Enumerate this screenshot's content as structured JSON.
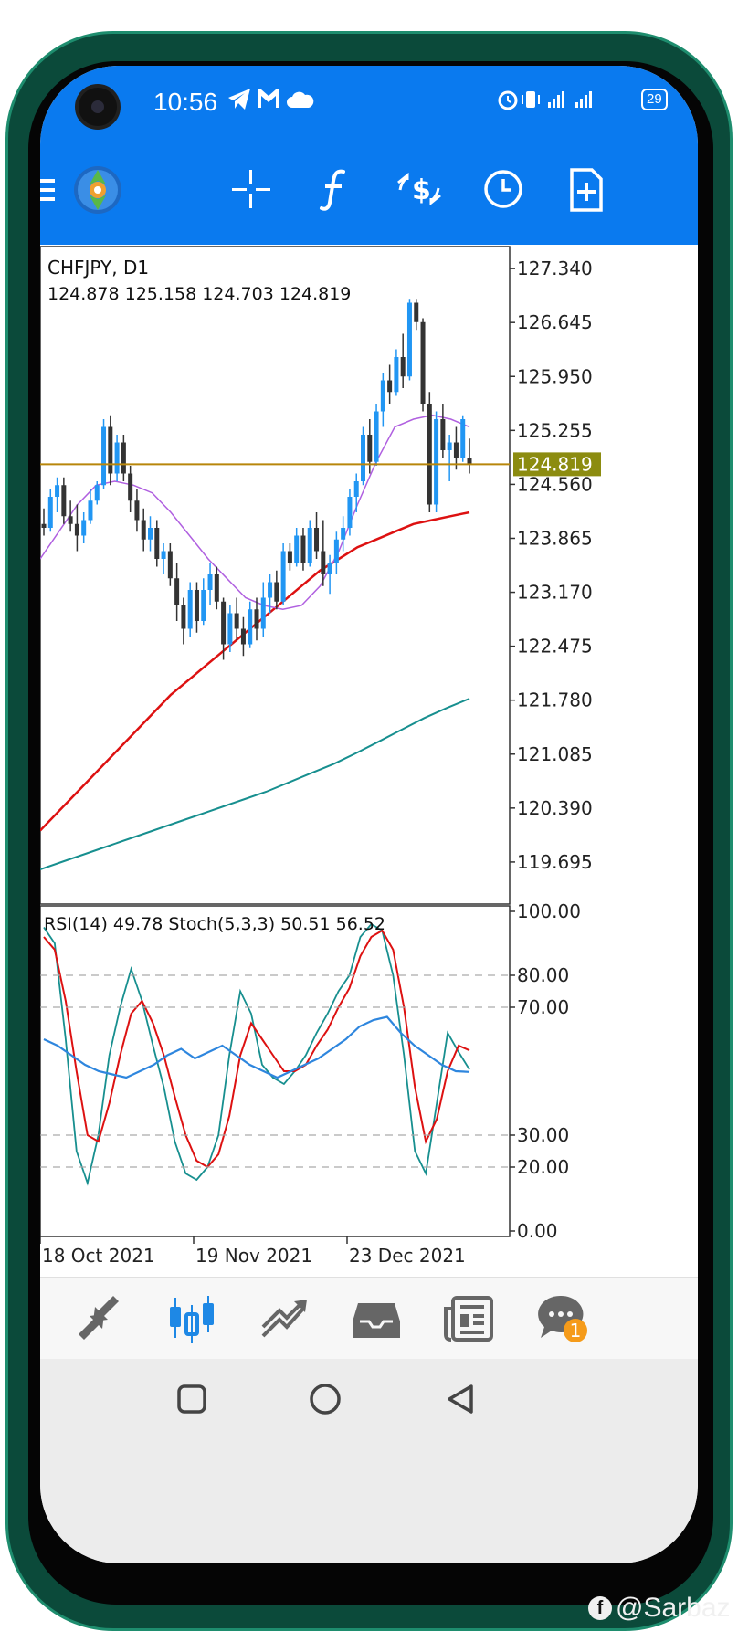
{
  "status_bar": {
    "time": "10:56",
    "battery": "29",
    "network": "4G"
  },
  "chart": {
    "symbol_title": "CHFJPY, D1",
    "ohlc": "124.878 125.158 124.703 124.819",
    "current_price": "124.819",
    "price_labels": [
      "127.340",
      "126.645",
      "125.950",
      "125.255",
      "124.560",
      "123.865",
      "123.170",
      "122.475",
      "121.780",
      "121.085",
      "120.390",
      "119.695"
    ],
    "indicator_label": "RSI(14) 49.78 Stoch(5,3,3) 50.51 56.52",
    "indicator_levels": [
      "100.00",
      "80.00",
      "70.00",
      "30.00",
      "20.00",
      "0.00"
    ],
    "date_labels": [
      "18 Oct 2021",
      "19 Nov 2021",
      "23 Dec 2021"
    ]
  },
  "chart_data": {
    "type": "line",
    "title": "CHFJPY, D1",
    "ylim": [
      119.2,
      127.6
    ],
    "current_price": 124.819,
    "colors": {
      "up": "#2196f3",
      "down": "#333333",
      "ma_fast": "#b060e0",
      "ma_mid": "#dd1111",
      "ma_slow": "#178f8f",
      "price_line": "#b8860b"
    },
    "candles": [
      [
        124.05,
        124.25,
        123.9,
        124.0
      ],
      [
        124.0,
        124.5,
        123.95,
        124.4
      ],
      [
        124.4,
        124.65,
        124.2,
        124.55
      ],
      [
        124.55,
        124.65,
        124.05,
        124.15
      ],
      [
        124.15,
        124.35,
        123.95,
        124.05
      ],
      [
        124.05,
        124.3,
        123.7,
        123.9
      ],
      [
        123.9,
        124.2,
        123.8,
        124.1
      ],
      [
        124.1,
        124.5,
        124.05,
        124.35
      ],
      [
        124.35,
        124.6,
        124.3,
        124.55
      ],
      [
        124.55,
        125.4,
        124.5,
        125.3
      ],
      [
        125.3,
        125.45,
        124.55,
        124.7
      ],
      [
        124.7,
        125.2,
        124.6,
        125.1
      ],
      [
        125.1,
        125.2,
        124.6,
        124.7
      ],
      [
        124.7,
        124.8,
        124.2,
        124.35
      ],
      [
        124.35,
        124.5,
        123.95,
        124.1
      ],
      [
        124.1,
        124.25,
        123.7,
        123.85
      ],
      [
        123.85,
        124.15,
        123.7,
        124.0
      ],
      [
        124.0,
        124.1,
        123.5,
        123.6
      ],
      [
        123.6,
        123.8,
        123.4,
        123.7
      ],
      [
        123.7,
        123.8,
        123.25,
        123.35
      ],
      [
        123.35,
        123.55,
        122.8,
        123.0
      ],
      [
        123.0,
        123.1,
        122.5,
        122.7
      ],
      [
        122.7,
        123.3,
        122.6,
        123.2
      ],
      [
        123.2,
        123.3,
        122.65,
        122.8
      ],
      [
        122.8,
        123.35,
        122.75,
        123.2
      ],
      [
        123.2,
        123.55,
        123.0,
        123.4
      ],
      [
        123.4,
        123.5,
        122.95,
        123.05
      ],
      [
        123.05,
        123.1,
        122.3,
        122.5
      ],
      [
        122.5,
        123.0,
        122.4,
        122.9
      ],
      [
        122.9,
        123.1,
        122.55,
        122.7
      ],
      [
        122.7,
        122.85,
        122.35,
        122.5
      ],
      [
        122.5,
        123.05,
        122.45,
        122.95
      ],
      [
        122.95,
        123.1,
        122.55,
        122.7
      ],
      [
        122.7,
        123.3,
        122.6,
        123.1
      ],
      [
        123.1,
        123.4,
        122.9,
        123.3
      ],
      [
        123.3,
        123.45,
        122.95,
        123.05
      ],
      [
        123.05,
        123.8,
        123.0,
        123.7
      ],
      [
        123.7,
        123.8,
        123.45,
        123.55
      ],
      [
        123.55,
        124.0,
        123.5,
        123.9
      ],
      [
        123.9,
        124.0,
        123.45,
        123.55
      ],
      [
        123.55,
        124.1,
        123.5,
        124.0
      ],
      [
        124.0,
        124.2,
        123.6,
        123.7
      ],
      [
        123.7,
        124.1,
        123.25,
        123.4
      ],
      [
        123.4,
        123.65,
        123.15,
        123.55
      ],
      [
        123.55,
        123.95,
        123.4,
        123.85
      ],
      [
        123.85,
        124.15,
        123.7,
        124.0
      ],
      [
        124.0,
        124.5,
        123.9,
        124.4
      ],
      [
        124.4,
        124.7,
        124.2,
        124.6
      ],
      [
        124.6,
        125.3,
        124.55,
        125.2
      ],
      [
        125.2,
        125.4,
        124.7,
        124.85
      ],
      [
        124.85,
        125.6,
        124.8,
        125.5
      ],
      [
        125.5,
        126.0,
        125.3,
        125.9
      ],
      [
        125.9,
        126.1,
        125.6,
        125.75
      ],
      [
        125.75,
        126.3,
        125.7,
        126.2
      ],
      [
        126.2,
        126.5,
        125.8,
        125.95
      ],
      [
        125.95,
        126.95,
        125.9,
        126.9
      ],
      [
        126.9,
        126.95,
        126.55,
        126.65
      ],
      [
        126.65,
        126.7,
        125.5,
        125.6
      ],
      [
        125.6,
        125.75,
        124.2,
        124.3
      ],
      [
        124.3,
        125.5,
        124.2,
        125.4
      ],
      [
        125.4,
        125.6,
        124.9,
        125.0
      ],
      [
        125.0,
        125.2,
        124.6,
        125.1
      ],
      [
        125.1,
        125.3,
        124.75,
        124.9
      ],
      [
        124.9,
        125.45,
        124.85,
        125.4
      ],
      [
        124.9,
        125.15,
        124.7,
        124.82
      ]
    ],
    "ma_fast": [
      123.6,
      123.95,
      124.3,
      124.55,
      124.6,
      124.55,
      124.45,
      124.2,
      123.9,
      123.6,
      123.35,
      123.1,
      123.0,
      122.95,
      123.0,
      123.25,
      123.7,
      124.3,
      124.85,
      125.3,
      125.4,
      125.45,
      125.4,
      125.3
    ],
    "ma_mid": [
      120.1,
      120.35,
      120.6,
      120.85,
      121.1,
      121.35,
      121.6,
      121.85,
      122.05,
      122.25,
      122.45,
      122.65,
      122.85,
      123.05,
      123.25,
      123.45,
      123.6,
      123.75,
      123.85,
      123.95,
      124.05,
      124.1,
      124.15,
      124.2
    ],
    "ma_slow": [
      119.6,
      119.7,
      119.8,
      119.9,
      120.0,
      120.1,
      120.2,
      120.3,
      120.4,
      120.5,
      120.6,
      120.72,
      120.84,
      120.96,
      121.1,
      121.25,
      121.4,
      121.55,
      121.68,
      121.8
    ],
    "rsi": [
      60,
      58,
      55,
      52,
      50,
      49,
      48,
      50,
      52,
      55,
      57,
      54,
      56,
      58,
      55,
      52,
      50,
      48,
      50,
      52,
      54,
      57,
      60,
      64,
      66,
      67,
      62,
      58,
      55,
      52,
      50,
      49.78
    ],
    "stoch_main": [
      95,
      90,
      60,
      25,
      15,
      30,
      55,
      70,
      82,
      72,
      58,
      45,
      28,
      18,
      16,
      20,
      30,
      55,
      75,
      68,
      52,
      48,
      46,
      50,
      55,
      62,
      68,
      75,
      80,
      92,
      96,
      94,
      80,
      55,
      25,
      18,
      40,
      62,
      56,
      50.51
    ],
    "stoch_signal": [
      92,
      88,
      72,
      50,
      30,
      28,
      40,
      55,
      68,
      72,
      65,
      55,
      42,
      30,
      22,
      20,
      24,
      36,
      55,
      65,
      60,
      55,
      50,
      50,
      52,
      58,
      63,
      70,
      76,
      86,
      92,
      94,
      88,
      70,
      45,
      28,
      35,
      50,
      58,
      56.52
    ]
  },
  "bottom_nav": [
    "quotes-icon",
    "chart-icon",
    "trade-icon",
    "history-icon",
    "news-icon",
    "messages-icon"
  ],
  "messages_badge": "1",
  "watermark": "@Sarbaz"
}
